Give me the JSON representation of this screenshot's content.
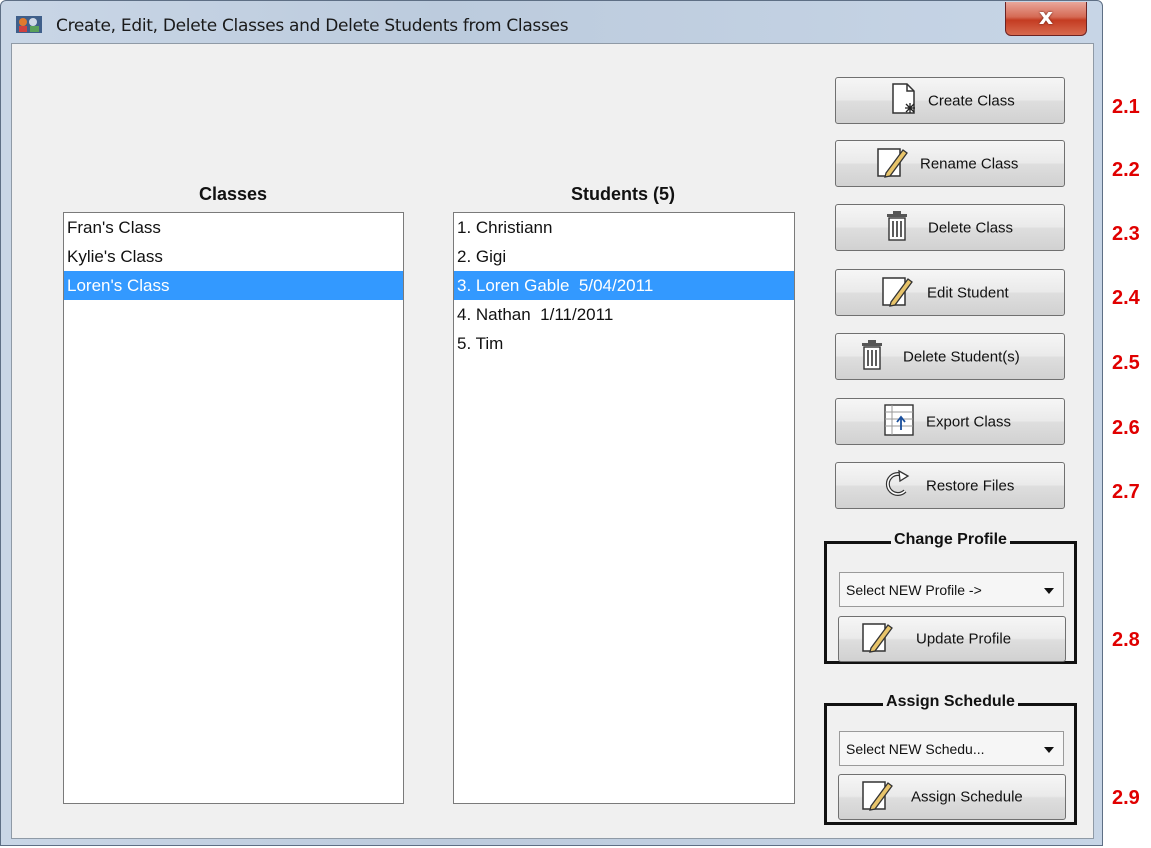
{
  "window": {
    "title": "Create, Edit, Delete Classes and Delete Students from Classes",
    "close_label": "x"
  },
  "classes": {
    "title": "Classes",
    "items": [
      "Fran's Class",
      "Kylie's Class",
      "Loren's Class"
    ],
    "selected_index": 2
  },
  "students": {
    "title": "Students (5)",
    "items": [
      "1. Christiann",
      "2. Gigi",
      "3. Loren Gable  5/04/2011",
      "4. Nathan  1/11/2011",
      "5. Tim"
    ],
    "selected_index": 2
  },
  "buttons": {
    "create_class": "Create Class",
    "rename_class": "Rename Class",
    "delete_class": "Delete Class",
    "edit_student": "Edit Student",
    "delete_students": "Delete Student(s)",
    "export_class": "Export Class",
    "restore_files": "Restore Files",
    "update_profile": "Update Profile",
    "assign_schedule": "Assign Schedule"
  },
  "change_profile": {
    "title": "Change Profile",
    "combo_value": "Select NEW Profile ->"
  },
  "assign_schedule_group": {
    "title": "Assign Schedule",
    "combo_value": "Select NEW Schedu..."
  },
  "step_labels": [
    "2.1",
    "2.2",
    "2.3",
    "2.4",
    "2.5",
    "2.6",
    "2.7",
    "2.8",
    "2.9"
  ],
  "colors": {
    "selection": "#3399ff",
    "step_label": "#e00000",
    "close_button": "#c43c22"
  }
}
